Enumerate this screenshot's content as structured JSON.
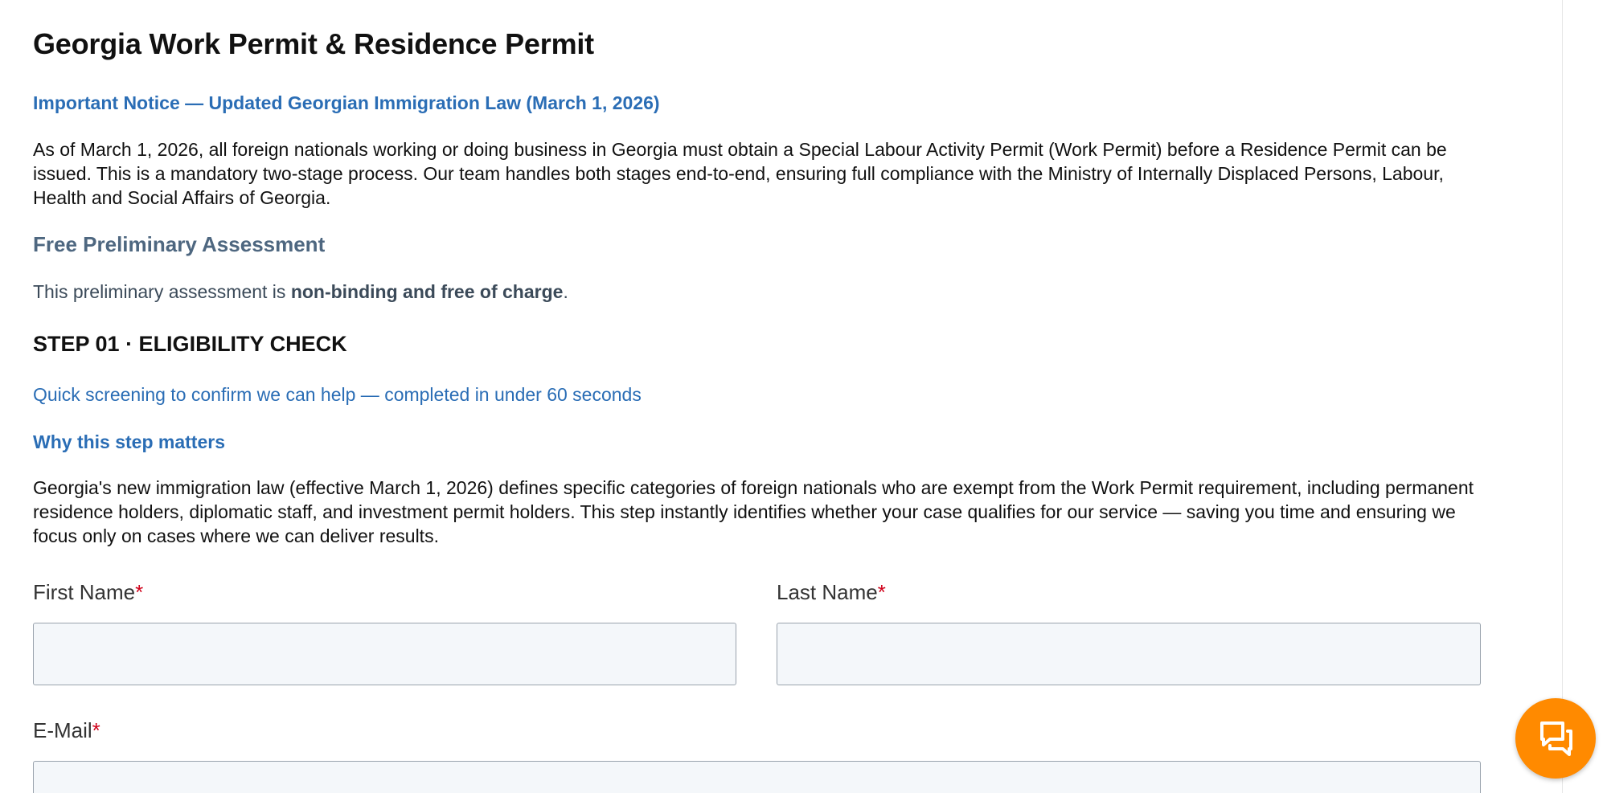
{
  "page": {
    "title": "Georgia Work Permit & Residence Permit"
  },
  "notice": {
    "title": "Important Notice — Updated Georgian Immigration Law (March 1, 2026)",
    "body": "As of March 1, 2026, all foreign nationals working or doing business in Georgia must obtain a Special Labour Activity Permit (Work Permit) before a Residence Permit can be issued. This is a mandatory two-stage process. Our team handles both stages end-to-end, ensuring full compliance with the Ministry of Internally Displaced Persons, Labour, Health and Social Affairs of Georgia."
  },
  "assessment": {
    "title": "Free Preliminary Assessment",
    "body_prefix": "This preliminary assessment is ",
    "body_bold": "non-binding and free of charge",
    "body_suffix": "."
  },
  "step": {
    "title": "STEP 01 · ELIGIBILITY CHECK",
    "subtitle": "Quick screening to confirm we can help — completed in under 60 seconds",
    "why_title": "Why this step matters",
    "why_body": "Georgia's new immigration law (effective March 1, 2026) defines specific categories of foreign nationals who are exempt from the Work Permit requirement, including permanent residence holders, diplomatic staff, and investment permit holders. This step instantly identifies whether your case qualifies for our service — saving you time and ensuring we focus only on cases where we can deliver results."
  },
  "form": {
    "first_name_label": "First Name",
    "first_name_value": "",
    "last_name_label": "Last Name",
    "last_name_value": "",
    "email_label": "E-Mail",
    "email_value": "",
    "required_mark": "*"
  },
  "chat": {
    "icon": "chat-bubbles-icon",
    "color": "#ff8a00"
  },
  "colors": {
    "link_blue": "#2a6db5",
    "muted_heading": "#4e6780",
    "required_red": "#d0021b"
  }
}
